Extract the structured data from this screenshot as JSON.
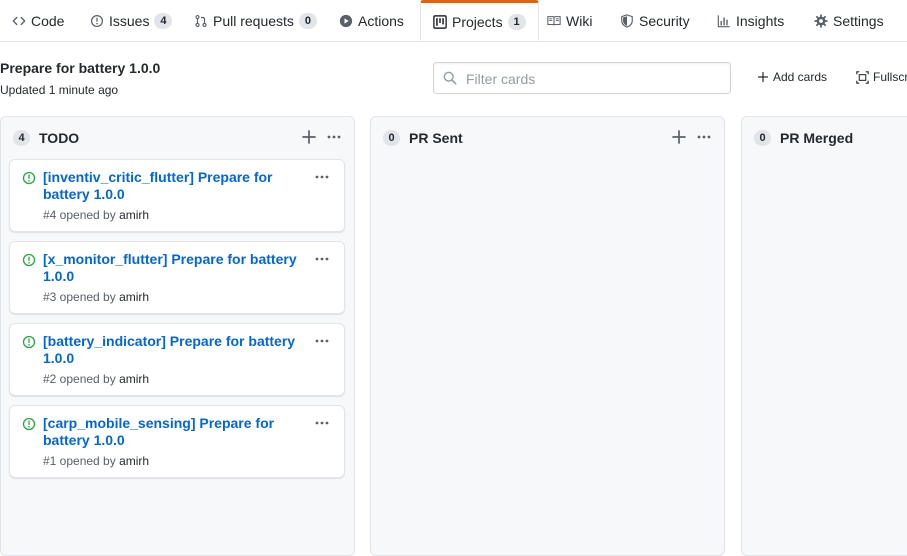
{
  "tabs": [
    {
      "label": "Code",
      "icon": "code-icon"
    },
    {
      "label": "Issues",
      "icon": "issue-icon",
      "count": "4"
    },
    {
      "label": "Pull requests",
      "icon": "pull-request-icon",
      "count": "0"
    },
    {
      "label": "Actions",
      "icon": "play-icon"
    },
    {
      "label": "Projects",
      "icon": "project-icon",
      "count": "1",
      "selected": true
    },
    {
      "label": "Wiki",
      "icon": "book-icon"
    },
    {
      "label": "Security",
      "icon": "shield-icon"
    },
    {
      "label": "Insights",
      "icon": "graph-icon"
    },
    {
      "label": "Settings",
      "icon": "gear-icon"
    }
  ],
  "project": {
    "title": "Prepare for battery 1.0.0",
    "updated": "Updated 1 minute ago",
    "filter_placeholder": "Filter cards",
    "add_cards_label": "Add cards",
    "fullscreen_label": "Fullscreen"
  },
  "columns": [
    {
      "name": "TODO",
      "count": "4",
      "cards": [
        {
          "title": "[inventiv_critic_flutter] Prepare for battery 1.0.0",
          "meta": "#4 opened by",
          "author": "amirh"
        },
        {
          "title": "[x_monitor_flutter] Prepare for battery 1.0.0",
          "meta": "#3 opened by",
          "author": "amirh"
        },
        {
          "title": "[battery_indicator] Prepare for battery 1.0.0",
          "meta": "#2 opened by",
          "author": "amirh"
        },
        {
          "title": "[carp_mobile_sensing] Prepare for battery 1.0.0",
          "meta": "#1 opened by",
          "author": "amirh"
        }
      ]
    },
    {
      "name": "PR Sent",
      "count": "0",
      "cards": []
    },
    {
      "name": "PR Merged",
      "count": "0",
      "cards": []
    }
  ],
  "colors": {
    "accent_tab": "#e36209",
    "link": "#0366d6",
    "issue_open": "#28a745",
    "column_bg": "#f6f8fa"
  }
}
